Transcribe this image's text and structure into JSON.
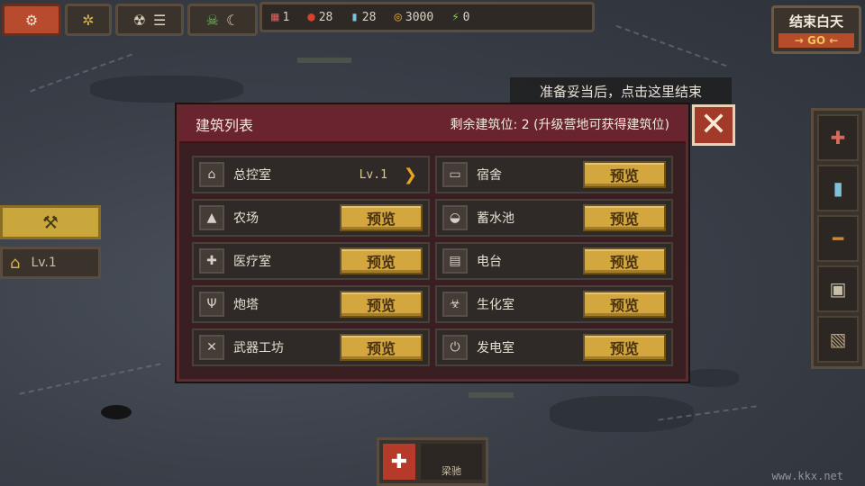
{
  "top": {
    "resources": [
      {
        "icon": "calendar-icon",
        "glyph": "▦",
        "value": "1",
        "color": "#d25a5a"
      },
      {
        "icon": "apple-icon",
        "glyph": "●",
        "value": "28",
        "color": "#d8422c"
      },
      {
        "icon": "water-bottle-icon",
        "glyph": "▮",
        "value": "28",
        "color": "#7fc1d9"
      },
      {
        "icon": "coins-icon",
        "glyph": "◎",
        "value": "3000",
        "color": "#d6a640"
      },
      {
        "icon": "energy-icon",
        "glyph": "⚡",
        "value": "0",
        "color": "#7fd14e"
      }
    ],
    "end_day_label": "结束白天",
    "go_label": "→ GO ←"
  },
  "hint_text": "准备妥当后，点击这里结束",
  "left": {
    "level_label": "Lv.1"
  },
  "dialog": {
    "title": "建筑列表",
    "slots_text": "剩余建筑位: 2 (升级营地可获得建筑位)",
    "left_column": [
      {
        "name": "总控室",
        "icon": "home-icon",
        "glyph": "⌂",
        "level": "Lv.1",
        "has_level": true
      },
      {
        "name": "农场",
        "icon": "farm-icon",
        "glyph": "▲",
        "preview": "预览"
      },
      {
        "name": "医疗室",
        "icon": "medical-icon",
        "glyph": "✚",
        "preview": "预览"
      },
      {
        "name": "炮塔",
        "icon": "turret-icon",
        "glyph": "Ψ",
        "preview": "预览"
      },
      {
        "name": "武器工坊",
        "icon": "weapons-icon",
        "glyph": "✕",
        "preview": "预览"
      }
    ],
    "right_column": [
      {
        "name": "宿舍",
        "icon": "bed-icon",
        "glyph": "▭",
        "preview": "预览"
      },
      {
        "name": "蓄水池",
        "icon": "water-tank-icon",
        "glyph": "◒",
        "preview": "预览"
      },
      {
        "name": "电台",
        "icon": "radio-icon",
        "glyph": "▤",
        "preview": "预览"
      },
      {
        "name": "生化室",
        "icon": "biohazard-icon",
        "glyph": "☣",
        "preview": "预览"
      },
      {
        "name": "发电室",
        "icon": "generator-icon",
        "glyph": "⏻",
        "preview": "预览"
      }
    ]
  },
  "bottom": {
    "character_name": "梁驰"
  },
  "watermark": "www.kkx.net"
}
